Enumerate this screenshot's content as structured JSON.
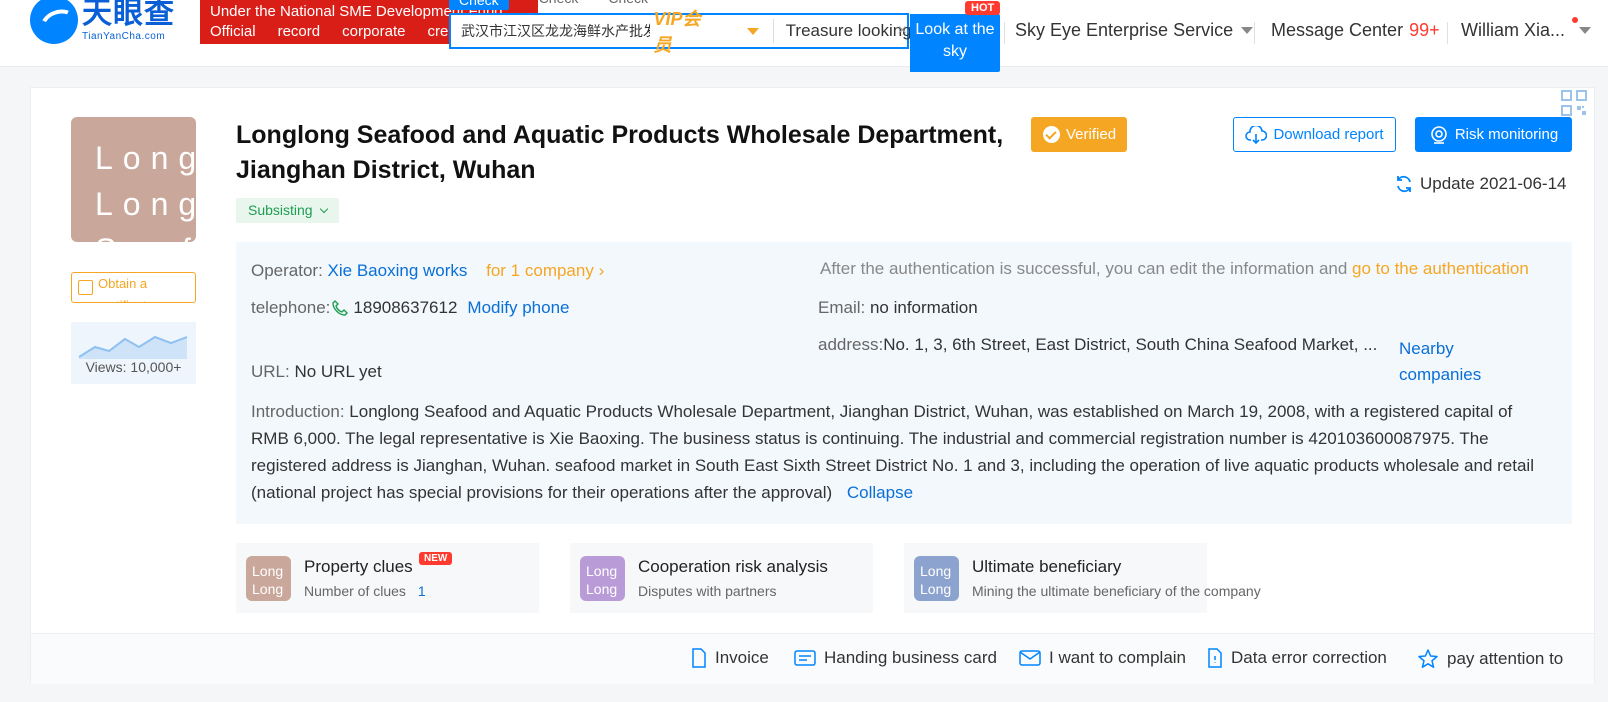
{
  "header": {
    "logo_cn": "天眼查",
    "logo_en": "TianYanCha.com",
    "banner_line1": "Under the National SME Development Fund",
    "banner_line2": [
      "Official",
      "record",
      "corporate",
      "credit"
    ],
    "search_tabs": [
      "Check",
      "Check",
      "Check"
    ],
    "search_value": "武汉市江汉区龙龙海鲜水产批发部",
    "vip_label": "VIP会员",
    "treasure_label": "Treasure looking",
    "search_button": "Look at the sky",
    "hot_badge": "HOT",
    "nav_enterprise": "Sky Eye Enterprise Service",
    "nav_messages": "Message Center",
    "message_count": "99+",
    "nav_user": "William Xia..."
  },
  "company": {
    "logo_text": "Long Long Seaf",
    "name": "Longlong Seafood and Aquatic Products Wholesale Department, Jianghan District, Wuhan",
    "verified_label": "Verified",
    "status": "Subsisting",
    "certificate_label": "Obtain a certificate",
    "views": "Views: 10,000+",
    "download_label": "Download report",
    "risk_label": "Risk monitoring",
    "update_label": "Update 2021-06-14"
  },
  "info": {
    "operator_label": "Operator:",
    "operator_value": "Xie Baoxing works",
    "operator_companies": "for 1 company",
    "auth_text": "After the authentication is successful, you can edit the information and",
    "auth_link": "go to the authentication",
    "phone_label": "telephone:",
    "phone_value": "18908637612",
    "modify_phone": "Modify phone",
    "email_label": "Email:",
    "email_value": "no information",
    "address_label": "address:",
    "address_value": "No. 1, 3, 6th Street, East District, South China Seafood Market, ...",
    "nearby_label": "Nearby companies",
    "url_label": "URL:",
    "url_value": "No URL yet",
    "intro_label": "Introduction:",
    "intro_text": "Longlong Seafood and Aquatic Products Wholesale Department, Jianghan District, Wuhan, was established on March 19, 2008, with a registered capital of RMB 6,000. The legal representative is Xie Baoxing. The business status is continuing. The industrial and commercial registration number is 420103600087975. The registered address is Jianghan, Wuhan. seafood market in South East Sixth Street District No. 1 and 3, including the operation of live aquatic products wholesale and retail (national project has special provisions for their operations after the approval)",
    "collapse_label": "Collapse"
  },
  "features": [
    {
      "logo": "Long Long Seaf",
      "title": "Property clues",
      "badge": "NEW",
      "sub": "Number of clues",
      "count": "1",
      "color": "#c9a79a"
    },
    {
      "logo": "Long Long Seaf",
      "title": "Cooperation risk analysis",
      "sub": "Disputes with partners",
      "color": "#b99bd8"
    },
    {
      "logo": "Long Long Seaf",
      "title": "Ultimate beneficiary",
      "sub": "Mining the ultimate beneficiary of the company",
      "color": "#8ca3cf"
    }
  ],
  "bottom_bar": {
    "invoice": "Invoice",
    "business_card": "Handing business card",
    "complain": "I want to complain",
    "error_correction": "Data error correction",
    "pay_attention": "pay attention to"
  },
  "colors": {
    "primary": "#0084ff",
    "accent_orange": "#f5a623",
    "banner_red": "#d91e18",
    "status_green": "#1e9e50"
  }
}
